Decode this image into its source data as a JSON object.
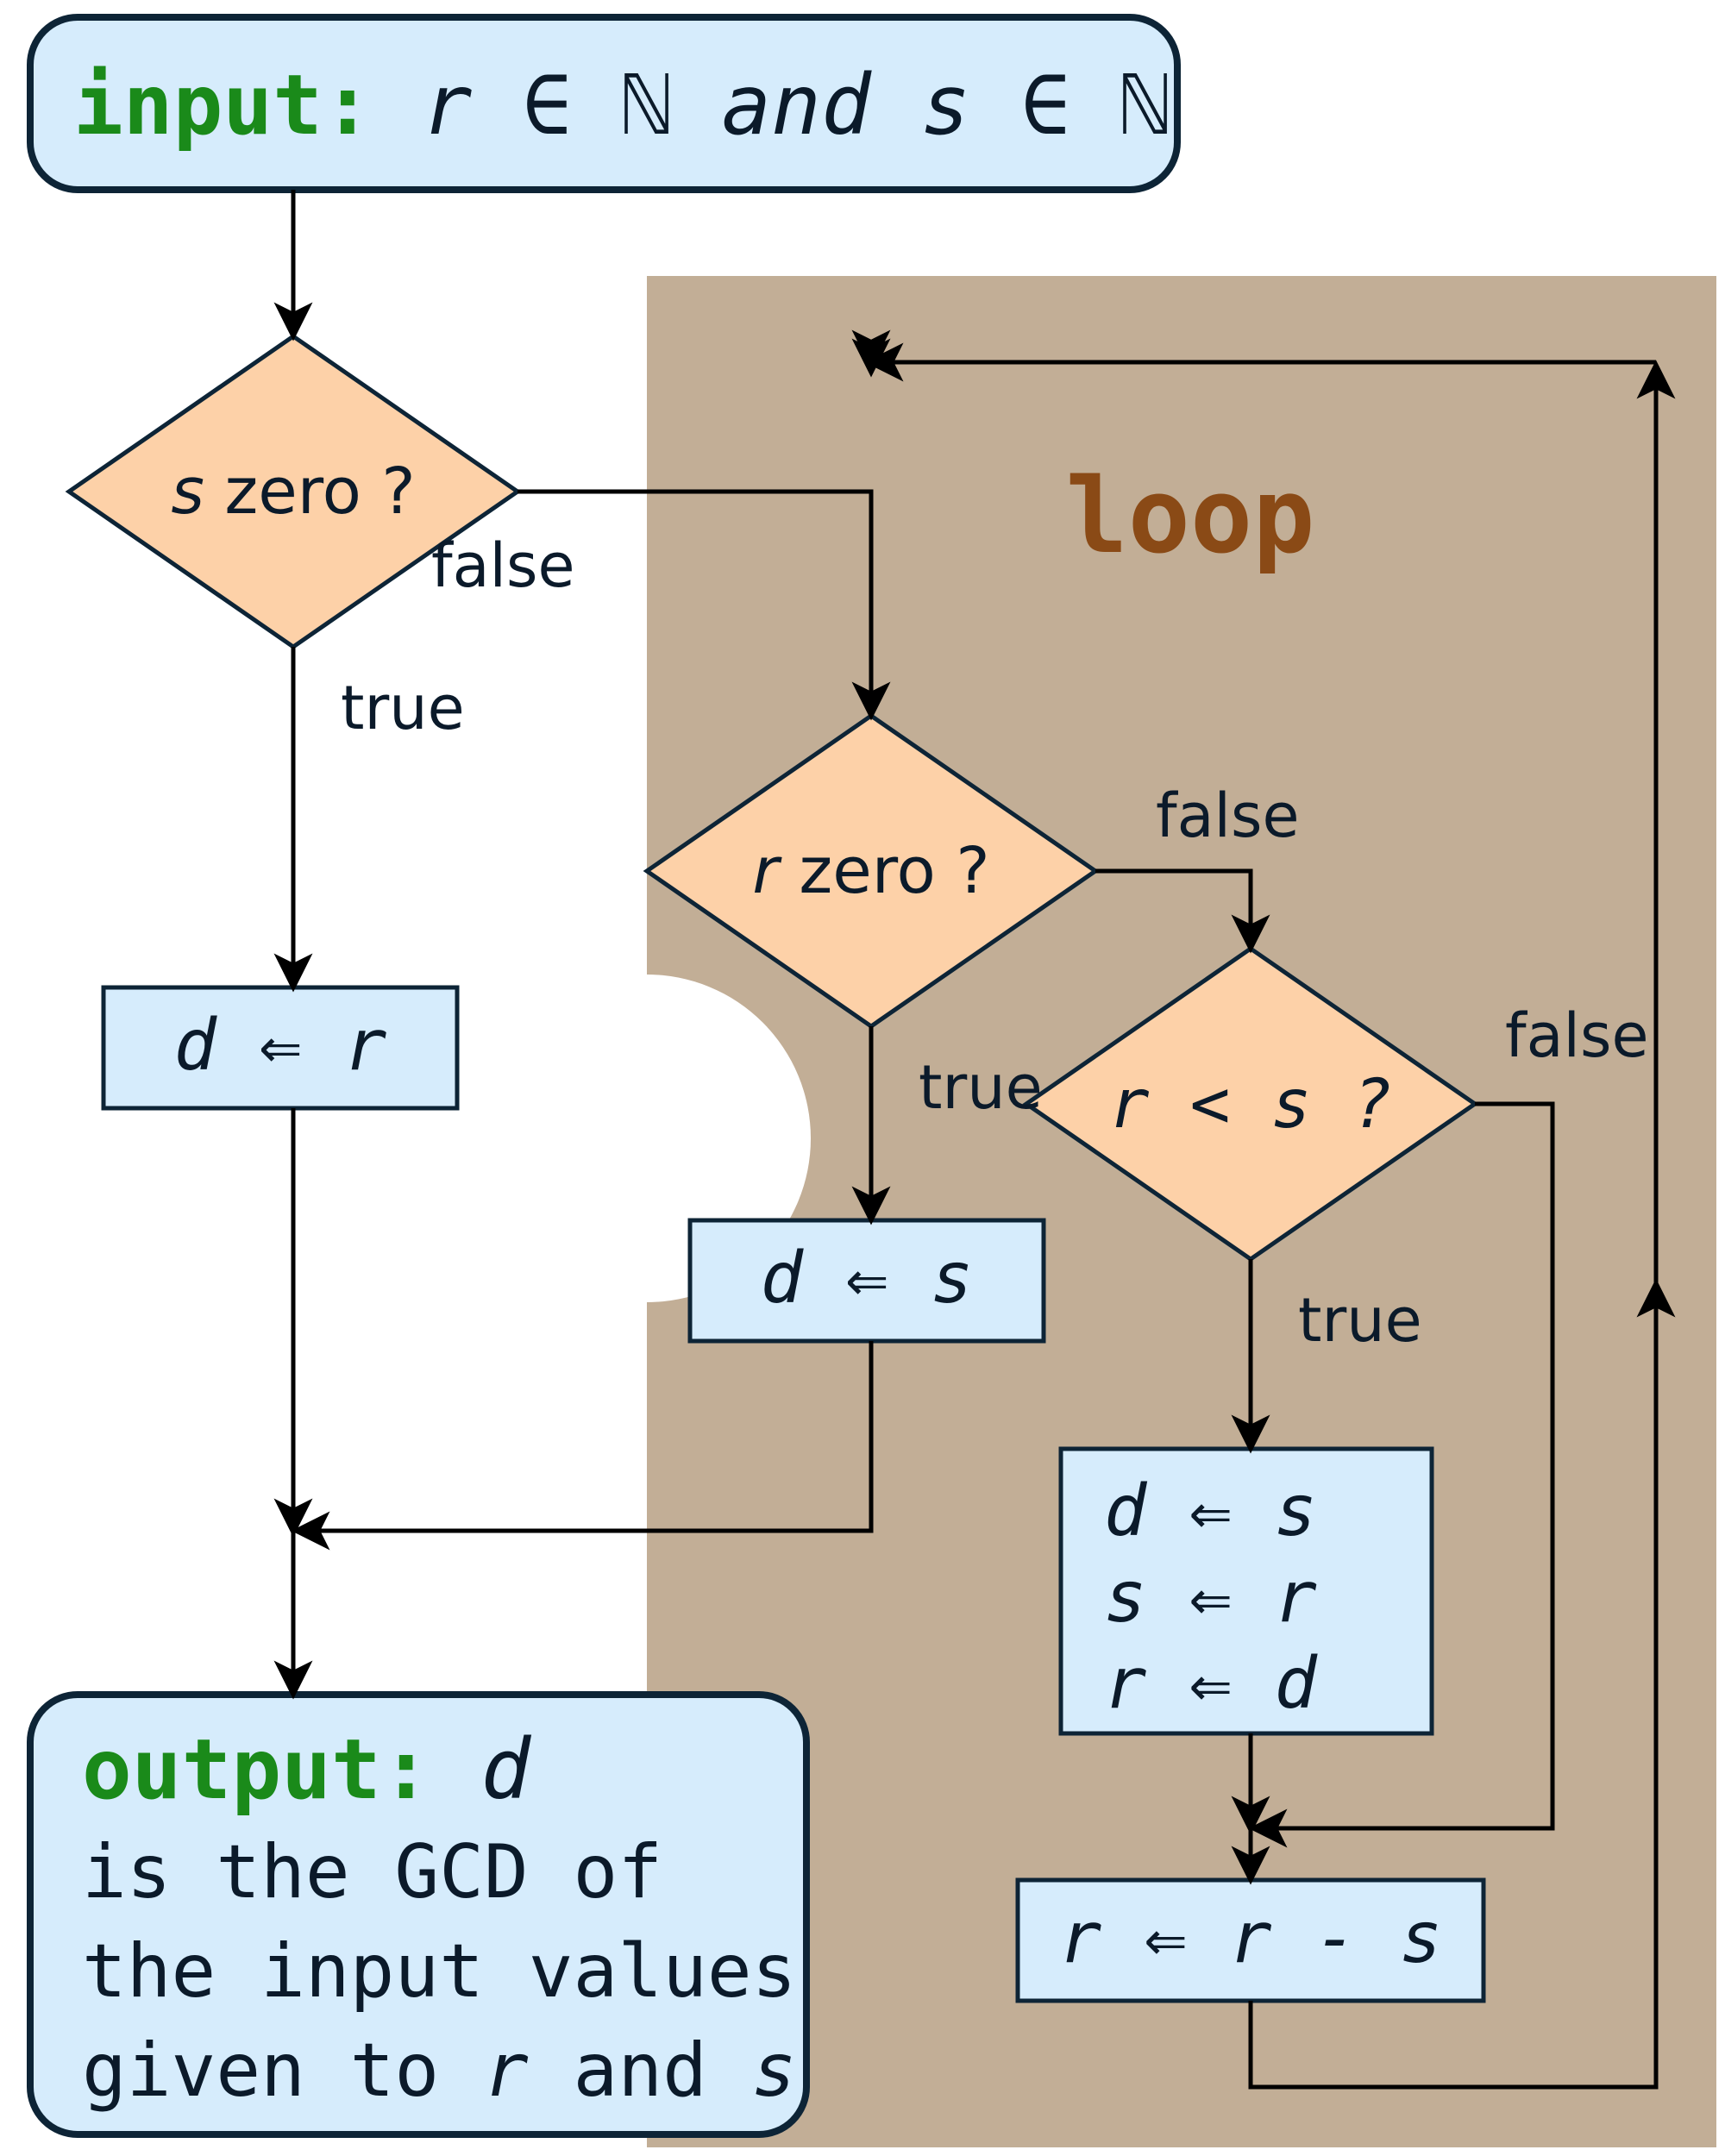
{
  "io": {
    "input_keyword": "input:",
    "input_expr": " r ∈ ℕ  and  s ∈ ℕ",
    "output_keyword": "output:",
    "output_var": " d",
    "output_line1": "is  the  GCD  of",
    "output_line2": "the  input values",
    "output_line3": "given to  r  and  s"
  },
  "decisions": {
    "s_zero": "s zero ?",
    "r_zero": "r zero ?",
    "r_lt_s": "r < s ?"
  },
  "processes": {
    "d_gets_r": "d ⇐ r",
    "d_gets_s": "d ⇐ s",
    "swap1": "d ⇐ s",
    "swap2": "s ⇐ r",
    "swap3": "r ⇐ d",
    "r_sub": "r ⇐ r - s"
  },
  "labels": {
    "true": "true",
    "false": "false",
    "loop": "loop"
  },
  "colors": {
    "io_fill": "#d6ecfc",
    "decision_fill": "#fdd1a8",
    "loop_bg": "#c2ae96",
    "loop_text": "#8a4a16",
    "keyword": "#1a8a1a",
    "stroke": "#0d2436"
  }
}
